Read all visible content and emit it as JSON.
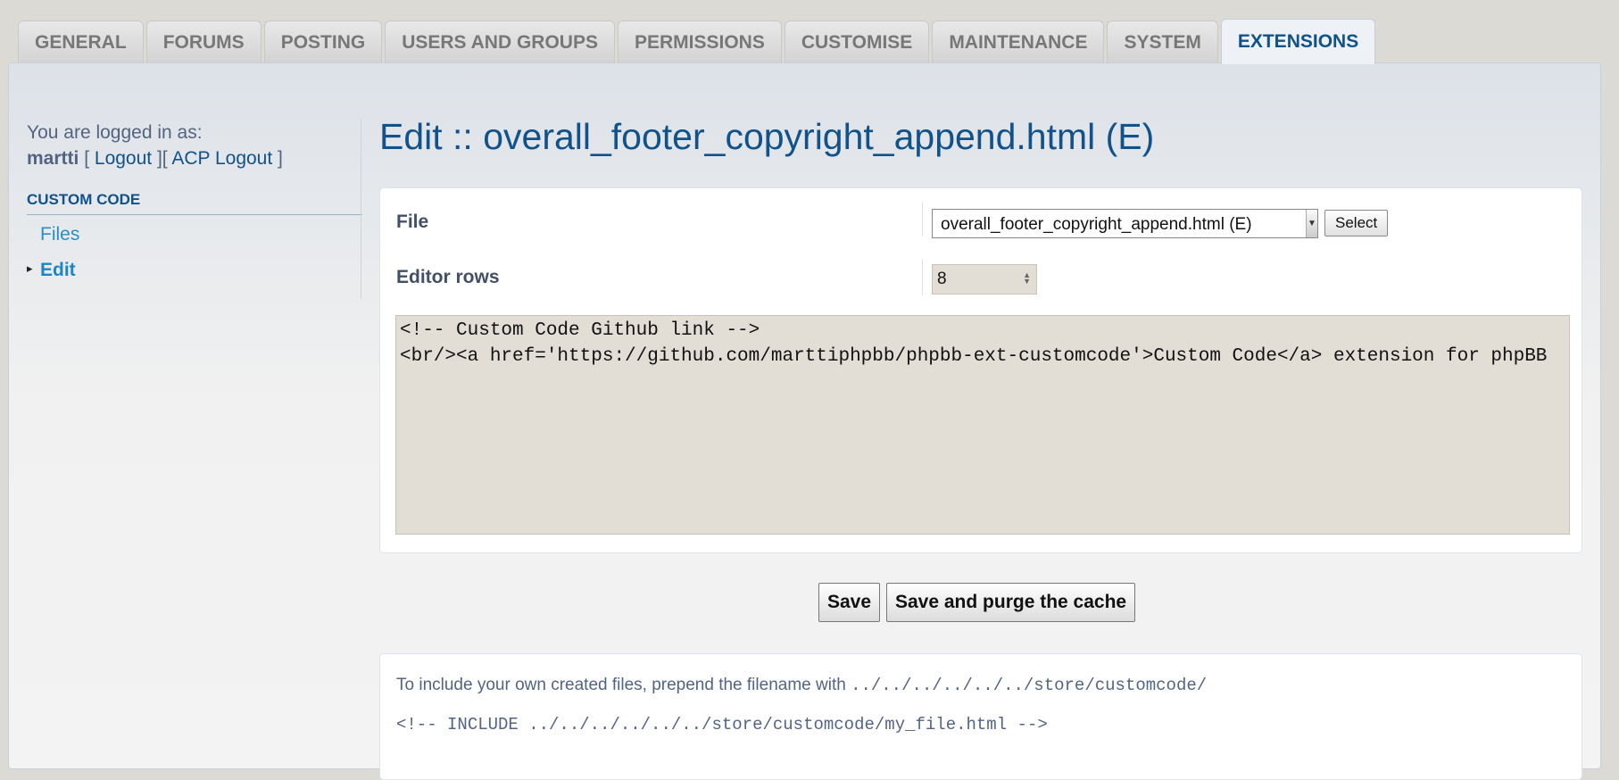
{
  "tabs": [
    {
      "label": "GENERAL",
      "active": false
    },
    {
      "label": "FORUMS",
      "active": false
    },
    {
      "label": "POSTING",
      "active": false
    },
    {
      "label": "USERS AND GROUPS",
      "active": false
    },
    {
      "label": "PERMISSIONS",
      "active": false
    },
    {
      "label": "CUSTOMISE",
      "active": false
    },
    {
      "label": "MAINTENANCE",
      "active": false
    },
    {
      "label": "SYSTEM",
      "active": false
    },
    {
      "label": "EXTENSIONS",
      "active": true
    }
  ],
  "sidebar": {
    "logged_in_text": "You are logged in as:",
    "username": "martti",
    "bracket_open": "[",
    "logout": "Logout",
    "bracket_mid": "][",
    "acp_logout": "ACP Logout",
    "bracket_close": "]",
    "section_header": "CUSTOM CODE",
    "items": [
      {
        "label": "Files",
        "active": false
      },
      {
        "label": "Edit",
        "active": true
      }
    ]
  },
  "main": {
    "title": "Edit :: overall_footer_copyright_append.html (E)",
    "file_label": "File",
    "file_selected": "overall_footer_copyright_append.html (E)",
    "select_button": "Select",
    "editor_rows_label": "Editor rows",
    "editor_rows_value": "8",
    "code": "<!-- Custom Code Github link -->\n<br/><a href='https://github.com/marttiphpbb/phpbb-ext-customcode'>Custom Code</a> extension for phpBB",
    "save_button": "Save",
    "save_purge_button": "Save and purge the cache"
  },
  "help": {
    "text": "To include your own created files, prepend the filename with ",
    "path": "../../../../../../store/customcode/",
    "example": "<!-- INCLUDE ../../../../../../store/customcode/my_file.html -->"
  },
  "colors": {
    "accent": "#105289",
    "background": "#dcdad5",
    "text": "#536482"
  }
}
